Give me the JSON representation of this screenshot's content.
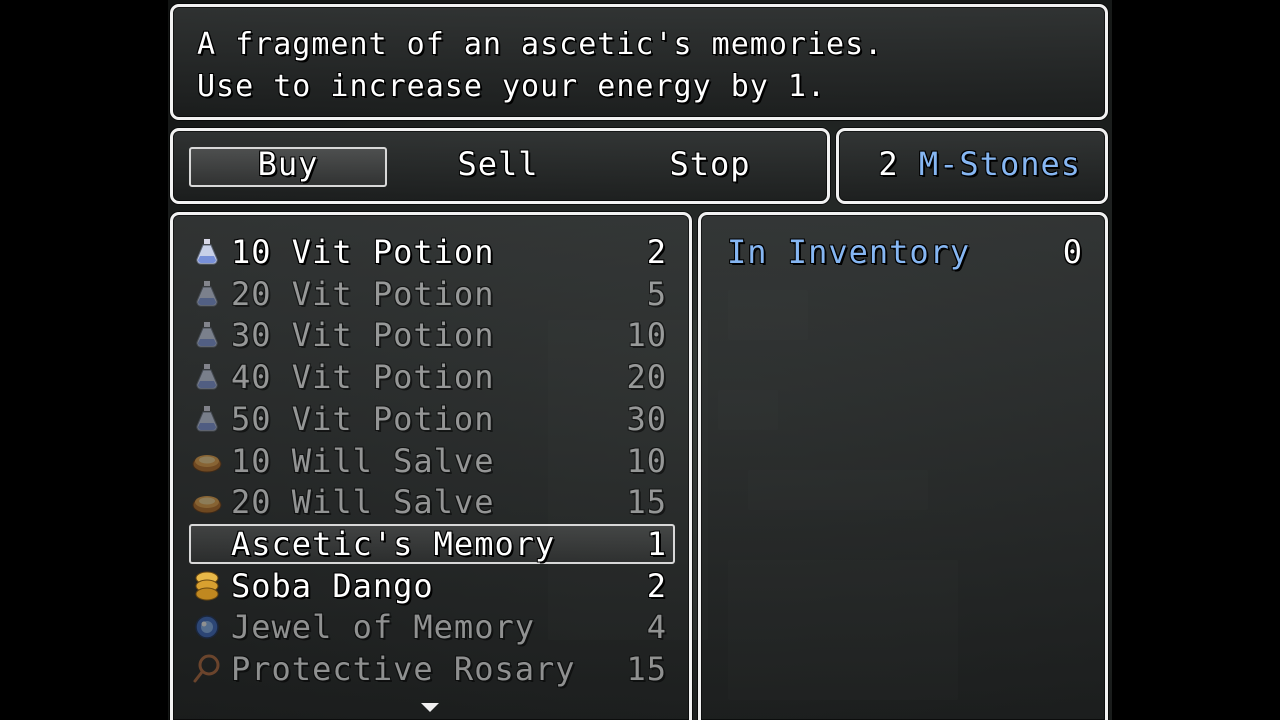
{
  "help": {
    "line1": "A fragment of an ascetic's memories.",
    "line2": "Use to increase your energy by 1."
  },
  "commands": {
    "buy": "Buy",
    "sell": "Sell",
    "stop": "Stop",
    "selected": "Buy"
  },
  "gold": {
    "amount": "2",
    "currency": "M-Stones"
  },
  "items": [
    {
      "name": "10 Vit Potion",
      "price": "2",
      "icon": "potion-icon",
      "enabled": true
    },
    {
      "name": "20 Vit Potion",
      "price": "5",
      "icon": "potion-icon",
      "enabled": false
    },
    {
      "name": "30 Vit Potion",
      "price": "10",
      "icon": "potion-icon",
      "enabled": false
    },
    {
      "name": "40 Vit Potion",
      "price": "20",
      "icon": "potion-icon",
      "enabled": false
    },
    {
      "name": "50 Vit Potion",
      "price": "30",
      "icon": "potion-icon",
      "enabled": false
    },
    {
      "name": "10 Will Salve",
      "price": "10",
      "icon": "salve-icon",
      "enabled": false
    },
    {
      "name": "20 Will Salve",
      "price": "15",
      "icon": "salve-icon",
      "enabled": false
    },
    {
      "name": "Ascetic's Memory",
      "price": "1",
      "icon": "",
      "enabled": true,
      "selected": true
    },
    {
      "name": "Soba Dango",
      "price": "2",
      "icon": "dango-icon",
      "enabled": true
    },
    {
      "name": "Jewel of Memory",
      "price": "4",
      "icon": "jewel-icon",
      "enabled": false
    },
    {
      "name": "Protective Rosary",
      "price": "15",
      "icon": "rosary-icon",
      "enabled": false
    }
  ],
  "status": {
    "label": "In Inventory",
    "count": "0"
  },
  "colors": {
    "system_blue": "#86b6f2",
    "frame": "#f2f2f2"
  }
}
